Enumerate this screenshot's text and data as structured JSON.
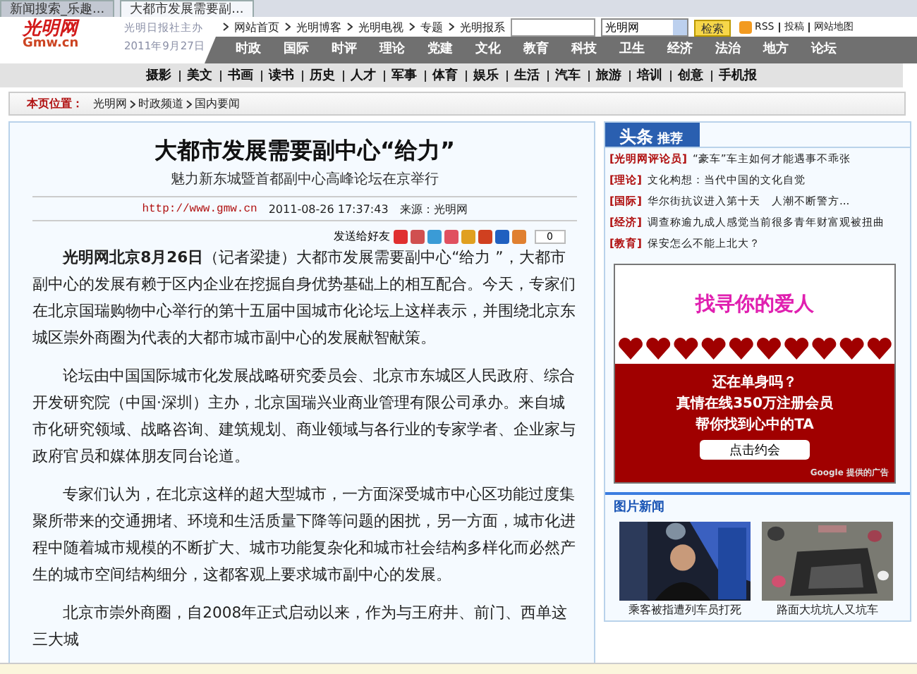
{
  "browser_tabs": [
    {
      "title": "新闻搜索_乐趣...",
      "selected": false
    },
    {
      "title": "大都市发展需要副...",
      "selected": true
    }
  ],
  "header": {
    "logo": "光明网",
    "logo_sub": "Gmw.cn",
    "publisher": "光明日报社主办",
    "date": "2011年9月27日",
    "top_links": [
      "网站首页",
      "光明博客",
      "光明电视",
      "专题",
      "光明报系"
    ],
    "search_scope": "光明网",
    "search_button": "检索",
    "rss": "RSS",
    "extra_links": [
      "投稿",
      "网站地图"
    ]
  },
  "main_nav": [
    "时政",
    "国际",
    "时评",
    "理论",
    "党建",
    "文化",
    "教育",
    "科技",
    "卫生",
    "经济",
    "法治",
    "地方",
    "论坛"
  ],
  "sub_nav": [
    "摄影",
    "美文",
    "书画",
    "读书",
    "历史",
    "人才",
    "军事",
    "体育",
    "娱乐",
    "生活",
    "汽车",
    "旅游",
    "培训",
    "创意",
    "手机报"
  ],
  "breadcrumb": {
    "label": "本页位置：",
    "path": [
      "光明网",
      "时政频道",
      "国内要闻"
    ]
  },
  "article": {
    "title": "大都市发展需要副中心“给力”",
    "subtitle": "魅力新东城暨首都副中心高峰论坛在京举行",
    "url": "http://www.gmw.cn",
    "datetime": "2011-08-26 17:37:43",
    "source": "来源：光明网",
    "share_label": "发送给好友",
    "share_count": "0",
    "paragraphs": [
      "**光明网北京8月26日**（记者梁捷）大都市发展需要副中心“给力 ”，大都市副中心的发展有赖于区内企业在挖掘自身优势基础上的相互配合。今天，专家们在北京国瑞购物中心举行的第十五届中国城市化论坛上这样表示，并围绕北京东城区崇外商圈为代表的大都市城市副中心的发展献智献策。",
      "论坛由中国国际城市化发展战略研究委员会、北京市东城区人民政府、综合开发研究院（中国·深圳）主办，北京国瑞兴业商业管理有限公司承办。来自城市化研究领域、战略咨询、建筑规划、商业领域与各行业的专家学者、企业家与政府官员和媒体朋友同台论道。",
      "专家们认为，在北京这样的超大型城市，一方面深受城市中心区功能过度集聚所带来的交通拥堵、环境和生活质量下降等问题的困扰，另一方面，城市化进程中随着城市规模的不断扩大、城市功能复杂化和城市社会结构多样化而必然产生的城市空间结构细分，这都客观上要求城市副中心的发展。",
      "北京市崇外商圈，自2008年正式启动以来，作为与王府井、前门、西单这三大城"
    ]
  },
  "headlines": {
    "tabs": [
      "头条",
      "推荐"
    ],
    "items": [
      {
        "category": "[光明网评论员]",
        "title": "“豪车”车主如何才能遇事不乖张"
      },
      {
        "category": "[理论]",
        "title": "文化构想：当代中国的文化自觉"
      },
      {
        "category": "[国际]",
        "title": "华尔街抗议进入第十天　人潮不断警方..."
      },
      {
        "category": "[经济]",
        "title": "调查称逾九成人感觉当前很多青年财富观被扭曲"
      },
      {
        "category": "[教育]",
        "title": "保安怎么不能上北大？"
      }
    ]
  },
  "ad": {
    "headline": "找寻你的爱人",
    "lines": [
      "还在单身吗？",
      "真情在线350万注册会员",
      "帮你找到心中的TA"
    ],
    "button": "点击约会",
    "provider": "Google 提供的广告"
  },
  "photo_news": {
    "title": "图片新闻",
    "items": [
      {
        "kind": "picture",
        "caption": "乘客被指遭列车员打死"
      },
      {
        "kind": "picture",
        "caption": "路面大坑坑人又坑车"
      }
    ]
  }
}
